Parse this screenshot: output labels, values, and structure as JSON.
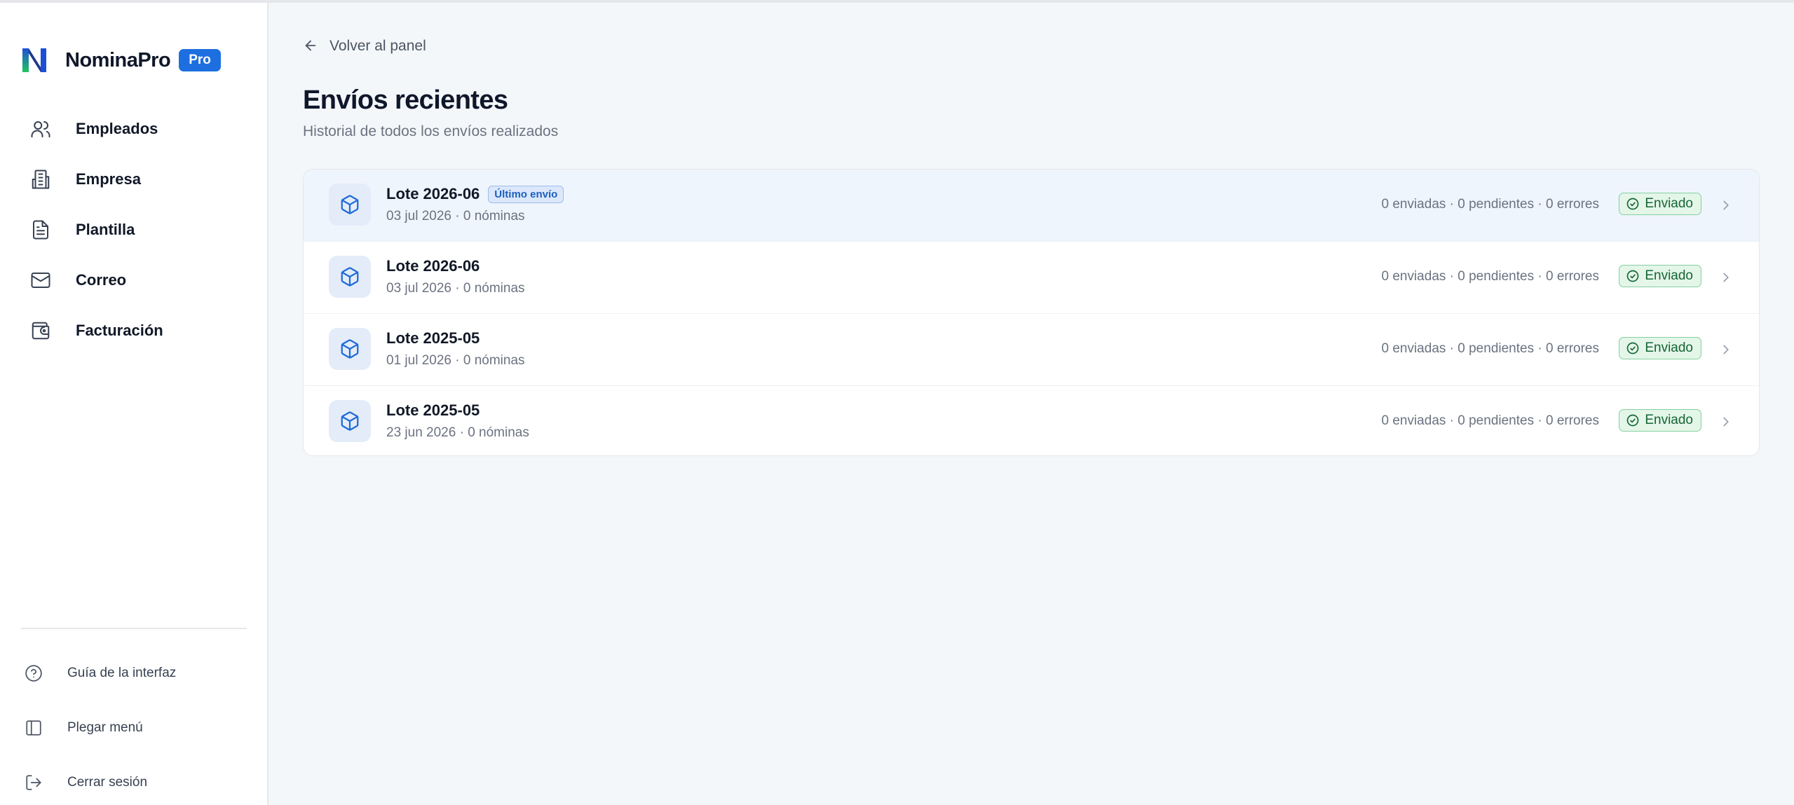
{
  "brand": {
    "name": "NominaPro",
    "badge": "Pro"
  },
  "nav": [
    {
      "label": "Empleados",
      "icon": "users-icon"
    },
    {
      "label": "Empresa",
      "icon": "building-icon"
    },
    {
      "label": "Plantilla",
      "icon": "document-icon"
    },
    {
      "label": "Correo",
      "icon": "mail-icon"
    },
    {
      "label": "Facturación",
      "icon": "wallet-icon"
    }
  ],
  "bottom_nav": [
    {
      "label": "Guía de la interfaz",
      "icon": "help-circle-icon"
    },
    {
      "label": "Plegar menú",
      "icon": "sidebar-collapse-icon"
    },
    {
      "label": "Cerrar sesión",
      "icon": "logout-icon"
    }
  ],
  "back": {
    "label": "Volver al panel"
  },
  "page": {
    "title": "Envíos recientes",
    "subtitle": "Historial de todos los envíos realizados"
  },
  "shipments": [
    {
      "name": "Lote 2026-06",
      "badge": "Último envío",
      "meta": "03 jul 2026 · 0 nóminas",
      "stats": "0 enviadas · 0 pendientes · 0 errores",
      "status": "Enviado"
    },
    {
      "name": "Lote 2026-06",
      "badge": "",
      "meta": "03 jul 2026 · 0 nóminas",
      "stats": "0 enviadas · 0 pendientes · 0 errores",
      "status": "Enviado"
    },
    {
      "name": "Lote 2025-05",
      "badge": "",
      "meta": "01 jul 2026 · 0 nóminas",
      "stats": "0 enviadas · 0 pendientes · 0 errores",
      "status": "Enviado"
    },
    {
      "name": "Lote 2025-05",
      "badge": "",
      "meta": "23 jun 2026 · 0 nóminas",
      "stats": "0 enviadas · 0 pendientes · 0 errores",
      "status": "Enviado"
    }
  ],
  "colors": {
    "accent": "#1d6fe0",
    "success": "#166534",
    "background": "#f4f7fa"
  }
}
